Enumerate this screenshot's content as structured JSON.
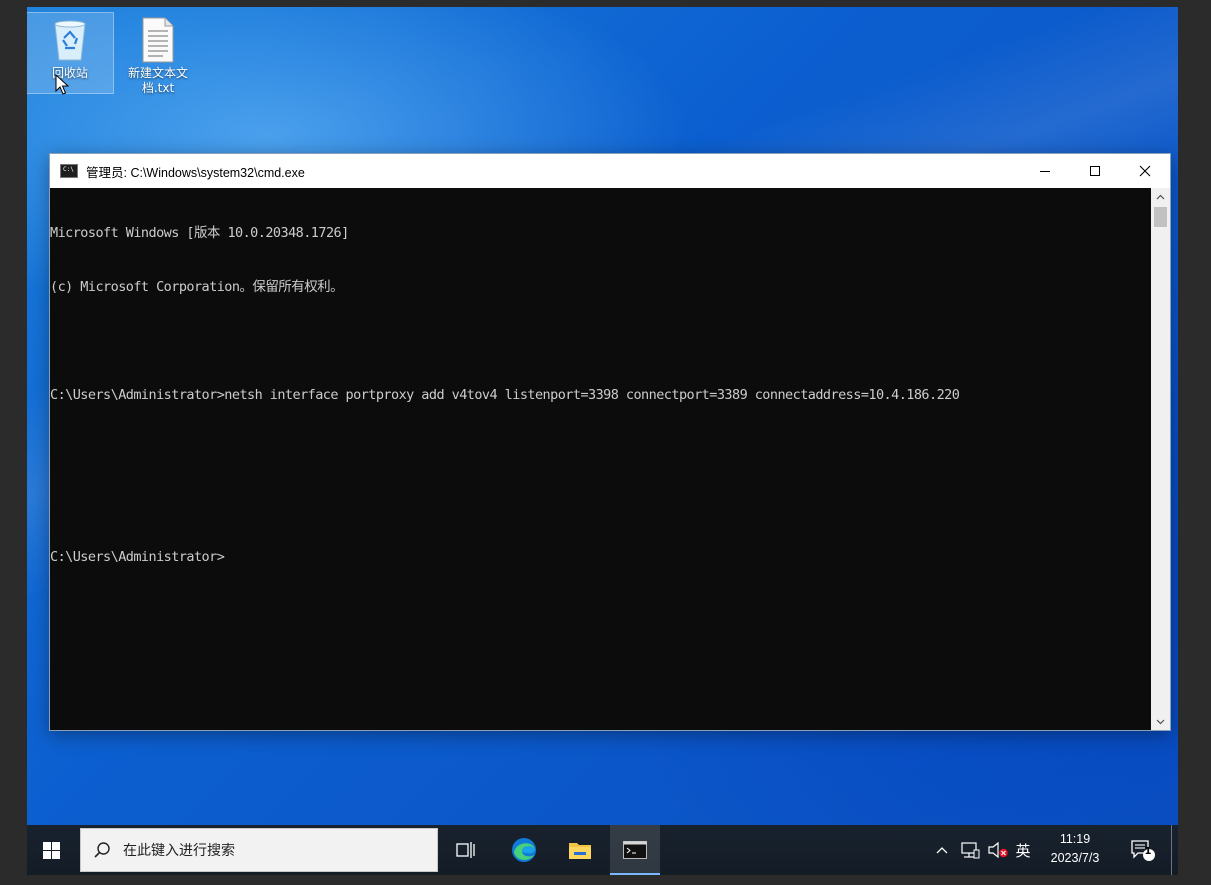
{
  "desktop": {
    "icons": [
      {
        "label": "回收站"
      },
      {
        "label": "新建文本文\n档.txt"
      }
    ]
  },
  "cmd_window": {
    "title": "管理员: C:\\Windows\\system32\\cmd.exe",
    "app_icon_text": "C:\\",
    "minimize_glyph": "—",
    "close_glyph": "✕",
    "console_lines": [
      "Microsoft Windows [版本 10.0.20348.1726]",
      "(c) Microsoft Corporation。保留所有权利。",
      "",
      "C:\\Users\\Administrator>netsh interface portproxy add v4tov4 listenport=3398 connectport=3389 connectaddress=10.4.186.220",
      "",
      "",
      "C:\\Users\\Administrator>"
    ]
  },
  "taskbar": {
    "search_placeholder": "在此键入进行搜索",
    "ime_label": "英",
    "time": "11:19",
    "date": "2023/7/3",
    "notification_count": "1",
    "tray_chevron": "^"
  },
  "colors": {
    "console_bg": "#0c0c0c",
    "console_text": "#cccccc",
    "taskbar_bg": "#18222e",
    "desktop_blue": "#0c5fd0"
  }
}
